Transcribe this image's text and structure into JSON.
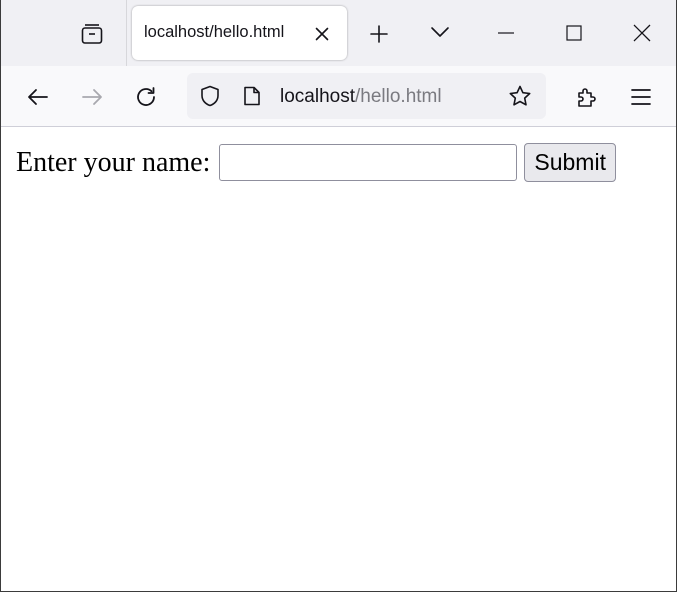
{
  "browser": {
    "tab": {
      "title": "localhost/hello.html"
    },
    "urlbar": {
      "host": "localhost",
      "path": "/hello.html"
    },
    "icons": {
      "tab_overview": "tab-overview-icon",
      "tab_close": "close-icon",
      "new_tab": "plus-icon",
      "tab_list": "chevron-down-icon",
      "minimize": "minimize-icon",
      "maximize": "maximize-icon",
      "close_window": "close-icon",
      "back": "arrow-left-icon",
      "forward": "arrow-right-icon",
      "reload": "reload-icon",
      "tracking_protection": "shield-icon",
      "page_info": "page-icon",
      "bookmark": "star-icon",
      "extensions": "puzzle-icon",
      "menu": "hamburger-icon"
    },
    "colors": {
      "tabstrip_bg": "#f0f0f4",
      "toolbar_bg": "#f9f9fb",
      "urlbar_bg": "#f0f0f4",
      "icon": "#15141a",
      "disabled_icon": "#a8a8ae",
      "url_path": "#7a7a80"
    }
  },
  "page": {
    "form": {
      "label": "Enter your name:",
      "input_value": "",
      "submit_label": "Submit"
    }
  }
}
